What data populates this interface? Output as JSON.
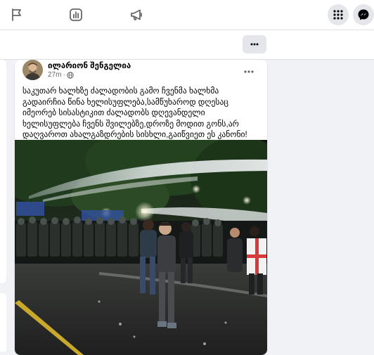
{
  "post": {
    "author": "ილარიონ შენგელია",
    "time": "27m",
    "dot": "·",
    "text": "საკუთარ ხალხზე ძალადობის გამო ჩვენმა ხალხმა გადაირჩია წინა ხელისუფლება,სამწუხაროდ დღესაც იმეორებ სისასტიკით ძალადობს დღევანდელი ხელისუფლება ჩვენს შვილებზე,დროზე მოდით გონს,არ დაღვაროთ ახალგაზდრების სისხლი,გაიწვიეთ ეს კანონი!"
  },
  "icons": {
    "nav": [
      "flag-icon",
      "chart-icon",
      "megaphone-icon"
    ],
    "menu": "grid-menu-icon",
    "messenger": "messenger-icon",
    "more": "more-horizontal-icon",
    "globe": "globe-icon"
  },
  "colors": {
    "accent": "#1877f2",
    "bar": "#ffffff",
    "background": "#f0f2f5"
  }
}
